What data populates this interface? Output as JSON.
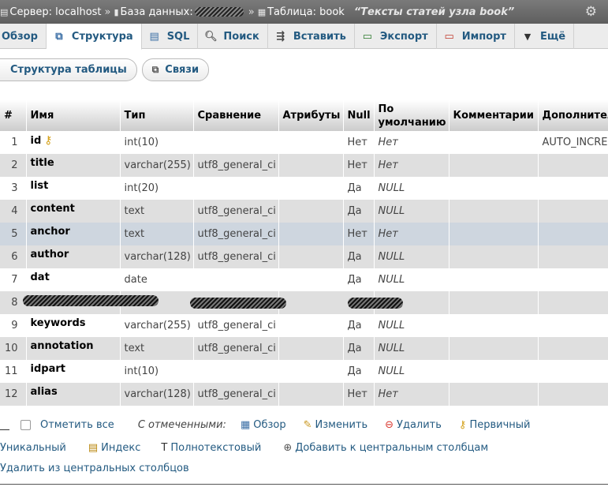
{
  "breadcrumb": {
    "server_label": "Сервер: localhost",
    "db_label": "База данных:",
    "table_label": "Таблица: book",
    "table_comment": "“Тексты статей узла book”"
  },
  "tabs": [
    {
      "label": "Обзор",
      "icon": "browse-icon"
    },
    {
      "label": "Структура",
      "icon": "structure-icon",
      "active": true
    },
    {
      "label": "SQL",
      "icon": "sql-icon"
    },
    {
      "label": "Поиск",
      "icon": "search-icon"
    },
    {
      "label": "Вставить",
      "icon": "insert-icon"
    },
    {
      "label": "Экспорт",
      "icon": "export-icon"
    },
    {
      "label": "Импорт",
      "icon": "import-icon"
    },
    {
      "label": "Ещё",
      "icon": "chevron-down-icon"
    }
  ],
  "subnav": {
    "table_structure": "Структура таблицы",
    "relations": "Связи"
  },
  "columns": [
    "#",
    "Имя",
    "Тип",
    "Сравнение",
    "Атрибуты",
    "Null",
    "По умолчанию",
    "Комментарии",
    "Дополнительно"
  ],
  "rows": [
    {
      "num": "1",
      "name": "id",
      "type": "int(10)",
      "collation": "",
      "attributes": "",
      "null": "Нет",
      "default": "Нет",
      "comment": "",
      "extra": "AUTO_INCREMENT"
    },
    {
      "num": "2",
      "name": "title",
      "type": "varchar(255)",
      "collation": "utf8_general_ci",
      "attributes": "",
      "null": "Нет",
      "default": "Нет",
      "comment": "",
      "extra": ""
    },
    {
      "num": "3",
      "name": "list",
      "type": "int(20)",
      "collation": "",
      "attributes": "",
      "null": "Да",
      "default": "NULL",
      "comment": "",
      "extra": ""
    },
    {
      "num": "4",
      "name": "content",
      "type": "text",
      "collation": "utf8_general_ci",
      "attributes": "",
      "null": "Да",
      "default": "NULL",
      "comment": "",
      "extra": ""
    },
    {
      "num": "5",
      "name": "anchor",
      "type": "text",
      "collation": "utf8_general_ci",
      "attributes": "",
      "null": "Нет",
      "default": "Нет",
      "comment": "",
      "extra": ""
    },
    {
      "num": "6",
      "name": "author",
      "type": "varchar(128)",
      "collation": "utf8_general_ci",
      "attributes": "",
      "null": "Да",
      "default": "NULL",
      "comment": "",
      "extra": ""
    },
    {
      "num": "7",
      "name": "dat",
      "type": "date",
      "collation": "",
      "attributes": "",
      "null": "Да",
      "default": "NULL",
      "comment": "",
      "extra": ""
    },
    {
      "num": "8",
      "name": "",
      "type": "",
      "collation": "",
      "attributes": "",
      "null": "",
      "default": "",
      "comment": "",
      "extra": ""
    },
    {
      "num": "9",
      "name": "keywords",
      "type": "varchar(255)",
      "collation": "utf8_general_ci",
      "attributes": "",
      "null": "Да",
      "default": "NULL",
      "comment": "",
      "extra": ""
    },
    {
      "num": "10",
      "name": "annotation",
      "type": "text",
      "collation": "utf8_general_ci",
      "attributes": "",
      "null": "Да",
      "default": "NULL",
      "comment": "",
      "extra": ""
    },
    {
      "num": "11",
      "name": "idpart",
      "type": "int(10)",
      "collation": "",
      "attributes": "",
      "null": "Да",
      "default": "NULL",
      "comment": "",
      "extra": ""
    },
    {
      "num": "12",
      "name": "alias",
      "type": "varchar(128)",
      "collation": "utf8_general_ci",
      "attributes": "",
      "null": "Нет",
      "default": "Нет",
      "comment": "",
      "extra": ""
    }
  ],
  "actions": {
    "check_all": "Отметить все",
    "with_selected": "С отмеченными:",
    "browse": "Обзор",
    "change": "Изменить",
    "drop": "Удалить",
    "primary": "Первичный",
    "unique": "Уникальный",
    "index": "Индекс",
    "fulltext": "Полнотекстовый",
    "add_central": "Добавить к центральным столбцам",
    "remove_central": "Удалить из центральных столбцов"
  },
  "colors": {
    "link": "#235a81",
    "row_alt": "#dfdfdf",
    "row_highlight": "#ced6df"
  }
}
